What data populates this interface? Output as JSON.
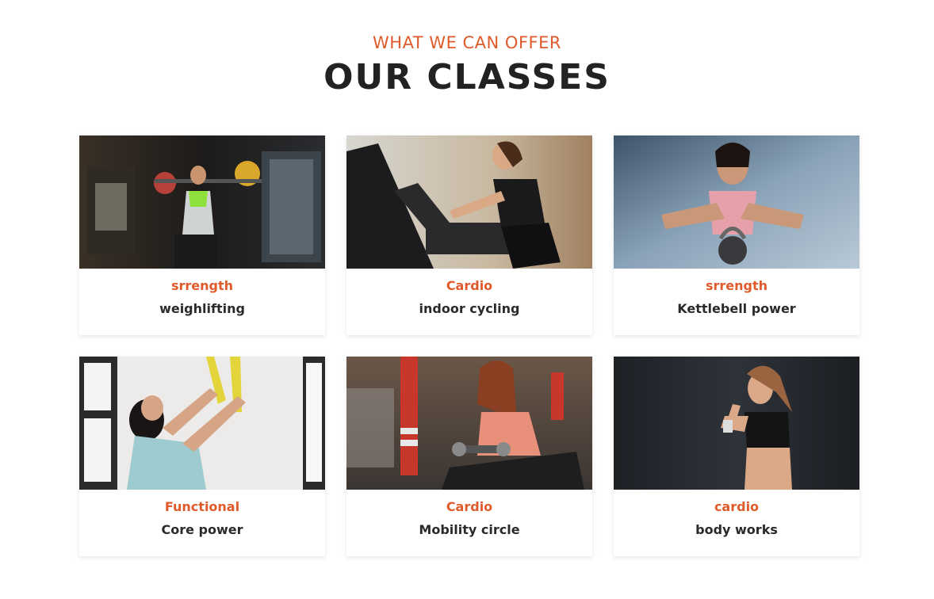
{
  "header": {
    "eyebrow": "WHAT WE CAN OFFER",
    "title": "OUR CLASSES"
  },
  "colors": {
    "accent": "#e05a2b",
    "text": "#2a2a2a"
  },
  "classes": [
    {
      "category": "srrength",
      "name": "weighlifting",
      "photo": "woman-barbell-squat-photo"
    },
    {
      "category": "Cardio",
      "name": "indoor cycling",
      "photo": "woman-exercise-bike-photo"
    },
    {
      "category": "srrength",
      "name": "Kettlebell power",
      "photo": "woman-kettlebell-photo"
    },
    {
      "category": "Functional",
      "name": "Core power",
      "photo": "woman-suspension-straps-photo"
    },
    {
      "category": "Cardio",
      "name": "Mobility circle",
      "photo": "woman-dumbbell-curl-photo"
    },
    {
      "category": "cardio",
      "name": "body works",
      "photo": "woman-dumbbell-bicep-photo"
    }
  ]
}
